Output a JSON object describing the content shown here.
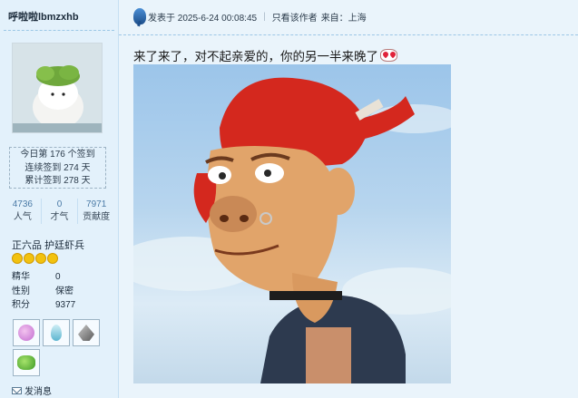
{
  "user": {
    "name": "呼啦啦lbmzxhb",
    "checkin": {
      "line1": "今日第 176 个签到",
      "line2": "连续签到 274 天",
      "line3": "累计签到 278 天"
    },
    "stats": [
      {
        "value": "4736",
        "label": "人气"
      },
      {
        "value": "0",
        "label": "才气"
      },
      {
        "value": "7971",
        "label": "贡献度"
      }
    ],
    "rank": "正六品 护廷虾兵",
    "info": [
      {
        "label": "精华",
        "value": "0"
      },
      {
        "label": "性别",
        "value": "保密"
      },
      {
        "label": "积分",
        "value": "9377"
      }
    ],
    "send_message": "发消息"
  },
  "post": {
    "posted_at": "发表于 2025-6-24 00:08:45",
    "only_author": "只看该作者",
    "origin": "来自：上海",
    "text": "来了来了，对不起亲爱的，你的另一半来晚了"
  },
  "colors": {
    "accent": "#4a7aa6",
    "background": "#eaf4fb",
    "sidebar": "#e3f1fb",
    "hair": "#d4281e"
  }
}
